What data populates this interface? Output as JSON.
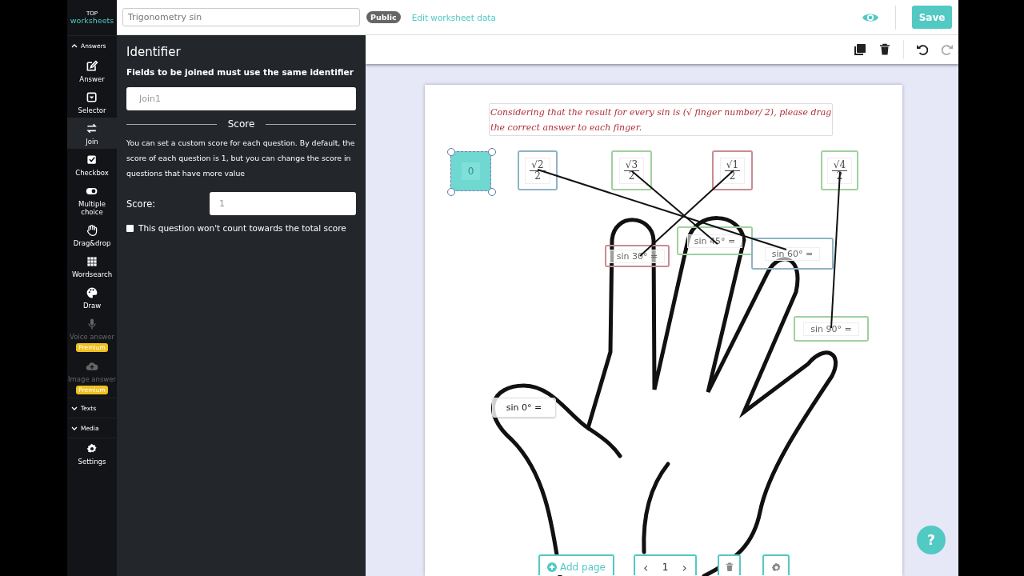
{
  "logo": {
    "top": "TOP",
    "bottom": "worksheets"
  },
  "top_bar": {
    "title_field": {
      "value": "Trigonometry sin"
    },
    "visibility_badge": "Public",
    "edit_link": "Edit worksheet data",
    "save_button": "Save"
  },
  "sidebar": {
    "sections": [
      {
        "label": "Answers",
        "expanded": true,
        "items": [
          {
            "label": "Answer",
            "selected": false,
            "disabled": false
          },
          {
            "label": "Selector",
            "selected": false,
            "disabled": false
          },
          {
            "label": "Join",
            "selected": true,
            "disabled": false
          },
          {
            "label": "Checkbox",
            "selected": false,
            "disabled": false
          },
          {
            "label": "Multiple choice",
            "selected": false,
            "disabled": false
          },
          {
            "label": "Drag&drop",
            "selected": false,
            "disabled": false
          },
          {
            "label": "Wordsearch",
            "selected": false,
            "disabled": false
          },
          {
            "label": "Draw",
            "selected": false,
            "disabled": false
          },
          {
            "label": "Voice answer",
            "selected": false,
            "disabled": true,
            "badge": "Premium"
          },
          {
            "label": "Image answer",
            "selected": false,
            "disabled": true,
            "badge": "Premium"
          }
        ]
      },
      {
        "label": "Texts",
        "expanded": false
      },
      {
        "label": "Media",
        "expanded": false
      }
    ],
    "settings": "Settings"
  },
  "panel": {
    "title": "Identifier",
    "subtitle": "Fields to be joined must use the same identifier",
    "identifier_field": {
      "value": "Join1"
    },
    "score_heading": "Score",
    "description": "You can set a custom score for each question. By default, the score of each question is 1, but you can change the score in questions that have more value",
    "score_label": "Score:",
    "score_field": {
      "value": "1"
    },
    "exclude_checkbox": {
      "label": "This question won't count towards the total score",
      "checked": false
    }
  },
  "worksheet": {
    "instruction": "Considering that the result for every sin is (√ finger number/ 2), please drag the correct answer to each finger.",
    "answers": [
      {
        "kind": "number",
        "text": "0",
        "selected": true
      },
      {
        "kind": "fraction",
        "numerator": "√2",
        "denominator": "2",
        "color": "#8fb3c4",
        "selected": false
      },
      {
        "kind": "fraction",
        "numerator": "√3",
        "denominator": "2",
        "color": "#9fd09f",
        "selected": false
      },
      {
        "kind": "fraction",
        "numerator": "√1",
        "denominator": "2",
        "color": "#c98b91",
        "selected": false
      },
      {
        "kind": "fraction",
        "numerator": "√4",
        "denominator": "2",
        "color": "#9fd09f",
        "selected": false
      }
    ],
    "slots": [
      {
        "text": "sin 30° =",
        "color": "#c98b91"
      },
      {
        "text": "sin 45° =",
        "color": "#9fd09f"
      },
      {
        "text": "sin 60° =",
        "color": "#8fb3c4"
      },
      {
        "text": "sin 90° =",
        "color": "#9fd09f"
      },
      {
        "text": "sin 0° ="
      }
    ]
  },
  "page_controls": {
    "add_page": "Add page",
    "page_number": "1",
    "prev": "‹",
    "next": "›"
  },
  "help_button": "?"
}
